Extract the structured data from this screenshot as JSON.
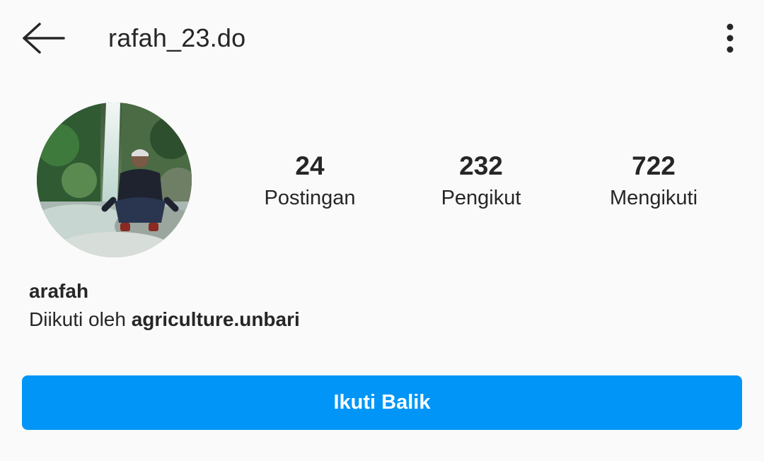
{
  "header": {
    "title": "rafah_23.do",
    "back_icon": "arrow-left-icon",
    "more_icon": "more-vertical-icon"
  },
  "profile": {
    "avatar_alt": "profile photo",
    "stats": [
      {
        "count": "24",
        "label": "Postingan"
      },
      {
        "count": "232",
        "label": "Pengikut"
      },
      {
        "count": "722",
        "label": "Mengikuti"
      }
    ],
    "display_name": "arafah",
    "followed_by_prefix": "Diikuti oleh ",
    "followed_by_user": "agriculture.unbari"
  },
  "actions": {
    "follow_back_label": "Ikuti Balik"
  },
  "colors": {
    "accent": "#0095f6",
    "text": "#262626",
    "background": "#fafafa"
  }
}
